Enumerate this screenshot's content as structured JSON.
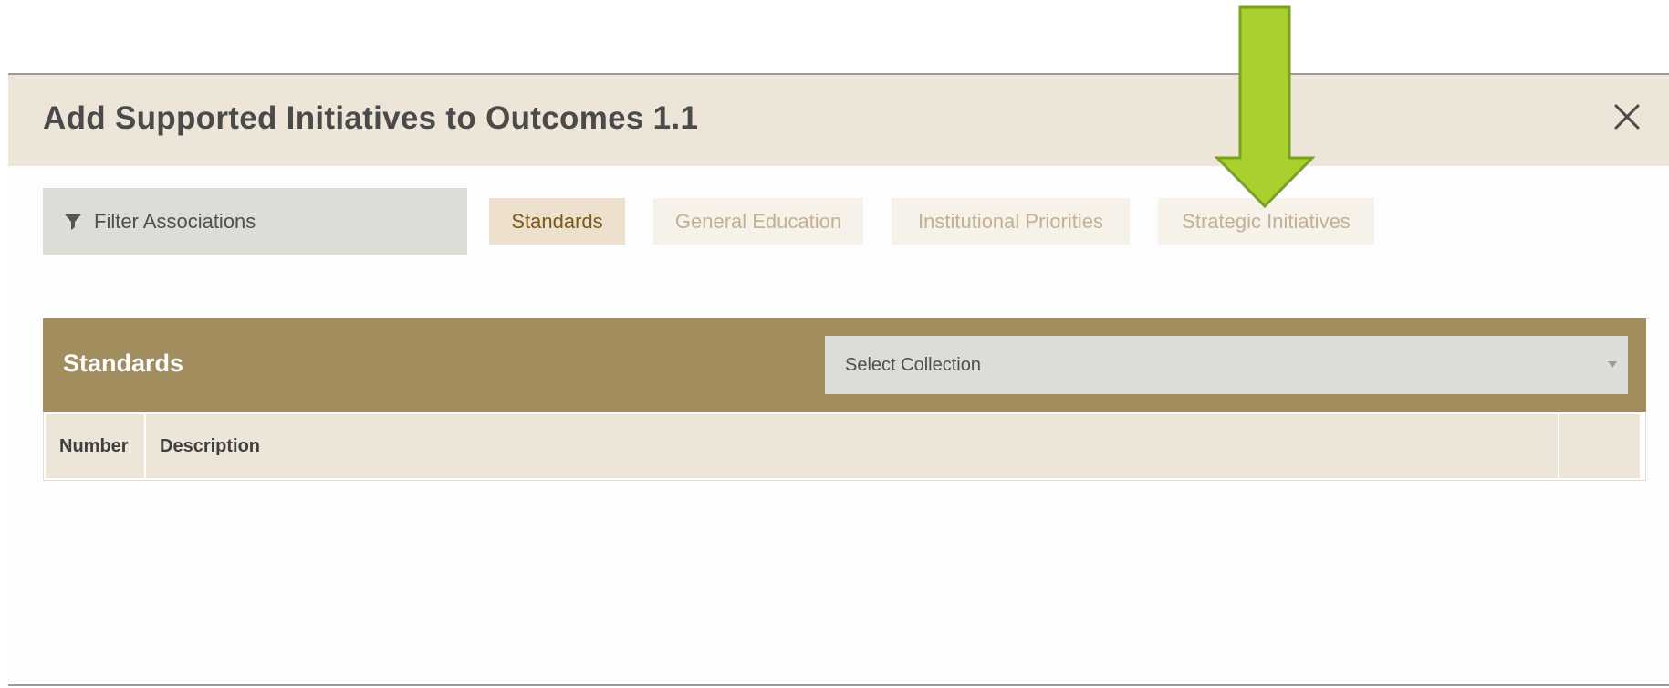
{
  "modal": {
    "title": "Add Supported Initiatives to Outcomes 1.1",
    "close_icon": "close-x-icon"
  },
  "filter": {
    "label": "Filter Associations",
    "icon": "filter-funnel-icon"
  },
  "tabs": [
    {
      "label": "Standards",
      "active": true
    },
    {
      "label": "General Education",
      "active": false
    },
    {
      "label": "Institutional Priorities",
      "active": false
    },
    {
      "label": "Strategic Initiatives",
      "active": false
    }
  ],
  "panel": {
    "title": "Standards",
    "select": {
      "value": "Select Collection",
      "icon": "dropdown-caret-icon"
    }
  },
  "table": {
    "columns": [
      "Number",
      "Description",
      ""
    ]
  },
  "annotation": {
    "icon": "green-arrow-down-icon",
    "color": "#a8d02e"
  },
  "colors": {
    "header_bg": "#ede5d8",
    "panel_bg": "#a28d5f",
    "active_tab_text": "#7b5a19",
    "inactive_tab_text": "#c3b093"
  }
}
